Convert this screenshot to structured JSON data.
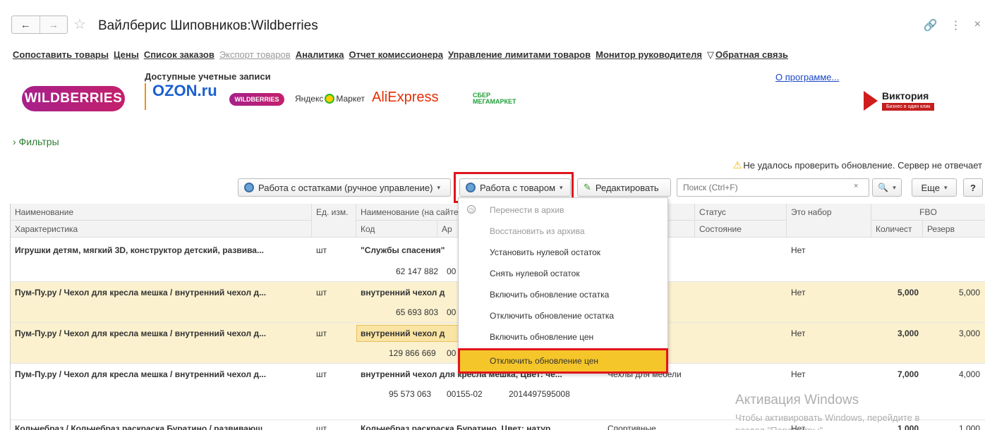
{
  "window": {
    "title": "Вайлберис Шиповников:Wildberries",
    "back": "←",
    "forward": "→",
    "star": "☆",
    "link_icon": "🔗",
    "menu_icon": "⋮",
    "close_icon": "×"
  },
  "menu": [
    {
      "label": "Сопоставить товары",
      "disabled": false
    },
    {
      "label": "Цены",
      "disabled": false
    },
    {
      "label": "Список заказов",
      "disabled": false
    },
    {
      "label": "Экспорт товаров",
      "disabled": true
    },
    {
      "label": "Аналитика",
      "disabled": false
    },
    {
      "label": "Отчет комиссионера",
      "disabled": false
    },
    {
      "label": "Управление лимитами товаров",
      "disabled": false
    },
    {
      "label": "Монитор руководителя",
      "disabled": false
    },
    {
      "label": "Обратная связь",
      "disabled": false
    }
  ],
  "accounts": {
    "label": "Доступные учетные записи",
    "wildberries": "WILDBERRIES",
    "ozon": "OZON.ru",
    "wildberries_small": "WILDBERRIES",
    "yandex": "Яндекс",
    "yandex_market": "Маркет",
    "aliexpress": "AliExpress",
    "sber_1": "СБЕР",
    "sber_2": "МЕГАМАРКЕТ"
  },
  "about": "О программе...",
  "victoria": {
    "name": "Виктория",
    "tagline": "Бизнес в один клик"
  },
  "filters": "› Фильтры",
  "warning": {
    "icon": "⚠",
    "text": "Не удалось проверить обновление. Сервер не отвечает"
  },
  "toolbar": {
    "stock_button": "Работа с остатками (ручное управление)",
    "goods_button": "Работа с товаром",
    "edit_button": "Редактировать",
    "search_placeholder": "Поиск (Ctrl+F)",
    "clear": "×",
    "find_icon": "🔍",
    "more": "Еще",
    "help": "?",
    "caret": "▾"
  },
  "table": {
    "headers": {
      "name": "Наименование",
      "characteristic": "Характеристика",
      "unit": "Ед. изм.",
      "site_name": "Наименование (на сайте)",
      "code": "Код",
      "article": "Ар",
      "status": "Статус",
      "state": "Состояние",
      "is_set": "Это набор",
      "fbo": "FBO",
      "qty": "Количест",
      "reserve": "Резерв"
    },
    "rows": [
      {
        "name": "Игрушки детям, мягкий 3D, конструктор детский, развива...",
        "unit": "шт",
        "site_name": "\"Службы спасения\"",
        "code": "62 147 882",
        "article": "00",
        "category": "",
        "is_set": "Нет",
        "qty": "",
        "reserve": "",
        "yellow": false
      },
      {
        "name": "Пум-Пу.ру / Чехол для кресла мешка / внутренний чехол д...",
        "unit": "шт",
        "site_name": "внутренний чехол д",
        "code": "65 693 803",
        "article": "00",
        "category": "",
        "is_set": "Нет",
        "qty": "5,000",
        "reserve": "5,000",
        "yellow": true
      },
      {
        "name": "Пум-Пу.ру / Чехол для кресла мешка / внутренний чехол д...",
        "unit": "шт",
        "site_name": "внутренний чехол д",
        "code": "129 866 669",
        "article": "00",
        "category": "",
        "is_set": "Нет",
        "qty": "3,000",
        "reserve": "3,000",
        "yellow": true
      },
      {
        "name": "Пум-Пу.ру / Чехол для кресла мешка / внутренний чехол д...",
        "unit": "шт",
        "site_name": "внутренний чехол для кресла мешка, Цвет: че...",
        "code": "95 573 063",
        "article": "00155-02",
        "barcode": "2014497595008",
        "category": "Чехлы для мебели",
        "is_set": "Нет",
        "qty": "7,000",
        "reserve": "4,000",
        "yellow": false
      },
      {
        "name": "Кольчебраз / Кольчебраз раскраска Буратино / развивающ...",
        "unit": "шт",
        "site_name": "Кольчебраз раскраска Буратино, Цвет: натур...",
        "category": "Спортивные",
        "is_set": "Нет",
        "qty": "1,000",
        "reserve": "1,000",
        "yellow": false
      }
    ]
  },
  "dropdown": [
    {
      "label": "Перенести в архив",
      "disabled": true,
      "icon": true
    },
    {
      "label": "Восстановить из архива",
      "disabled": true
    },
    {
      "label": "Установить нулевой остаток",
      "disabled": false
    },
    {
      "label": "Снять нулевой остаток",
      "disabled": false
    },
    {
      "label": "Включить обновление остатка",
      "disabled": false
    },
    {
      "label": "Отключить обновление остатка",
      "disabled": false
    },
    {
      "label": "Включить обновление цен",
      "disabled": false
    },
    {
      "label": "Отключить обновление цен",
      "disabled": false,
      "active": true
    }
  ],
  "watermark": {
    "title": "Активация Windows",
    "line1": "Чтобы активировать Windows, перейдите в",
    "line2": "раздел \"Параметры\"."
  },
  "colors": {
    "accent_red": "#e0151d",
    "active_item": "#f5c62a",
    "row_yellow": "#fbf1cf"
  }
}
